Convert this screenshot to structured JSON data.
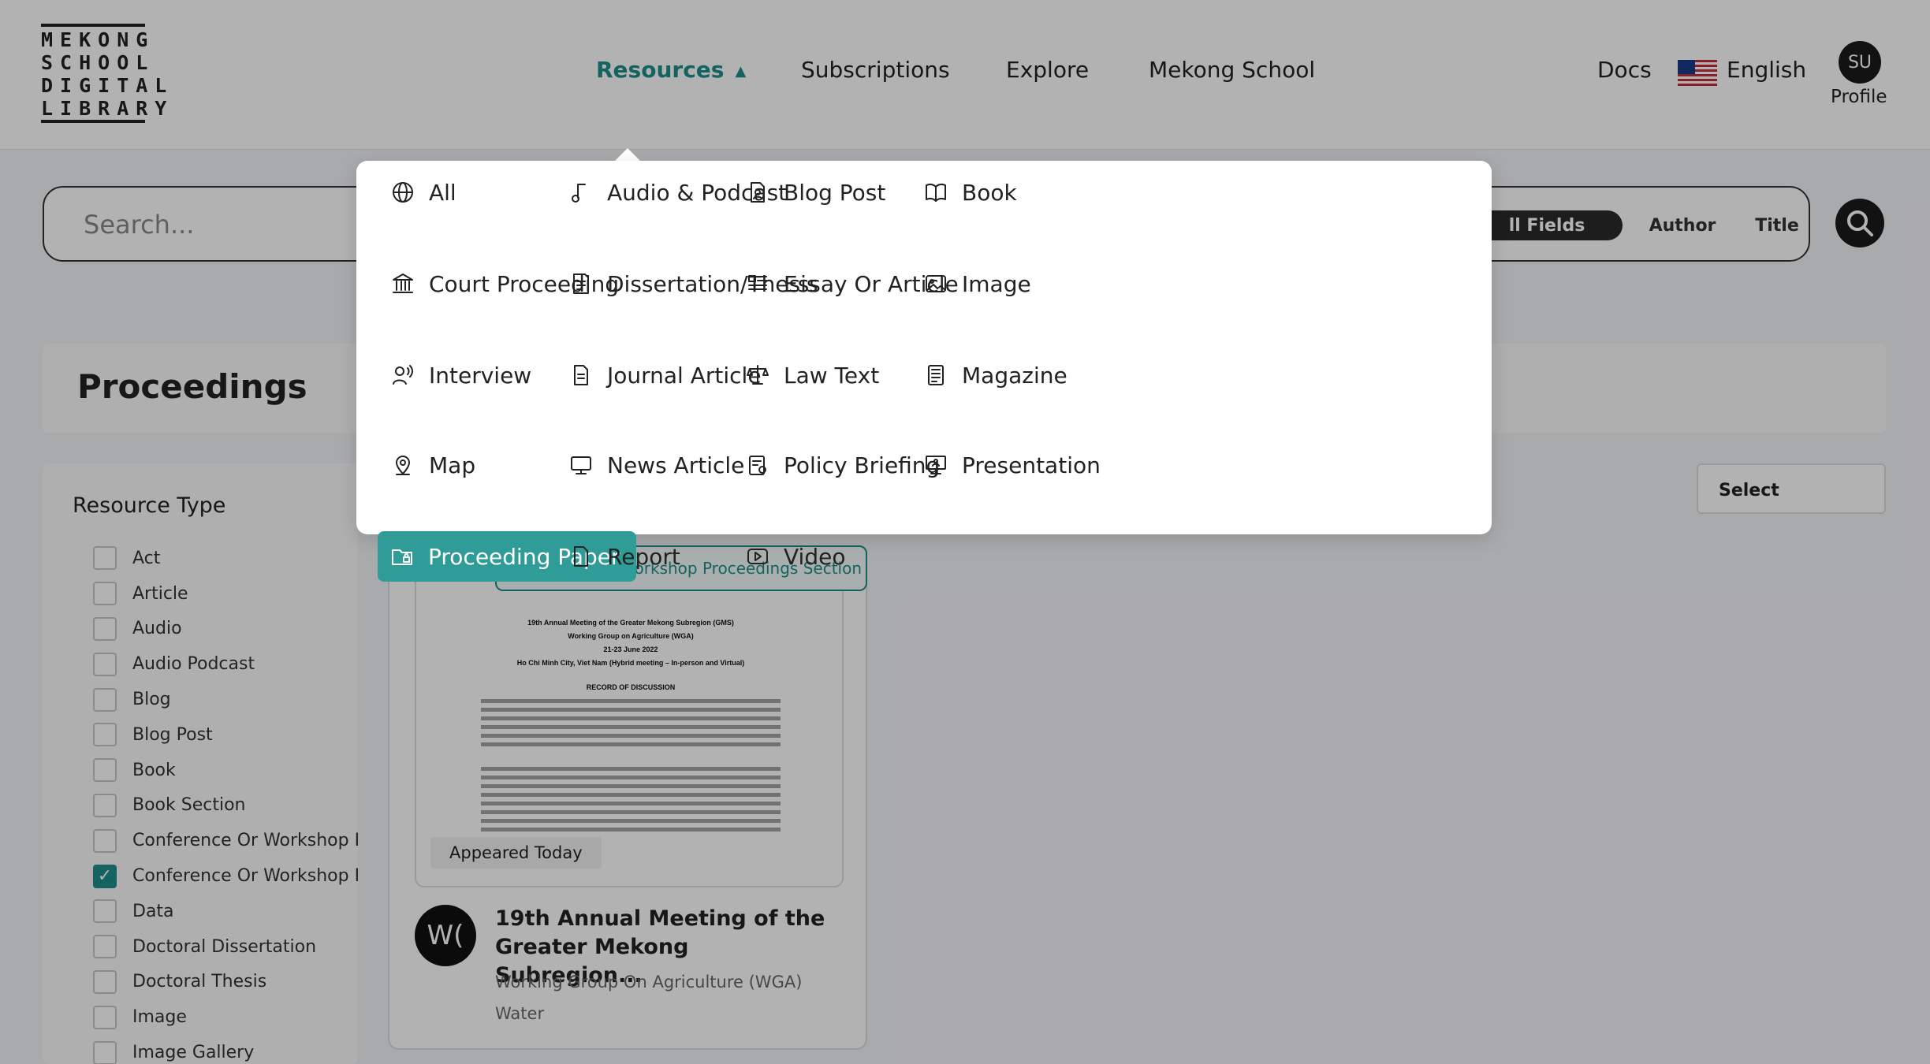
{
  "header": {
    "logo_lines": [
      "MEKONG",
      "SCHOOL",
      "DIGITAL",
      "LIBRARY"
    ],
    "nav": [
      {
        "label": "Resources",
        "active": true
      },
      {
        "label": "Subscriptions"
      },
      {
        "label": "Explore"
      },
      {
        "label": "Mekong School"
      }
    ],
    "docs_label": "Docs",
    "language": "English",
    "avatar_initials": "SU",
    "profile_label": "Profile"
  },
  "search": {
    "placeholder": "Search...",
    "scopes": [
      "All Fields",
      "Author",
      "Title"
    ],
    "active_scope_visible": "ll Fields"
  },
  "page": {
    "title": "Proceedings",
    "sort_select": "Select"
  },
  "sidebar": {
    "heading": "Resource Type",
    "filters": [
      {
        "label": "Act",
        "checked": false
      },
      {
        "label": "Article",
        "checked": false
      },
      {
        "label": "Audio",
        "checked": false
      },
      {
        "label": "Audio Podcast",
        "checked": false
      },
      {
        "label": "Blog",
        "checked": false
      },
      {
        "label": "Blog Post",
        "checked": false
      },
      {
        "label": "Book",
        "checked": false
      },
      {
        "label": "Book Section",
        "checked": false
      },
      {
        "label": "Conference Or Workshop Pr",
        "checked": false
      },
      {
        "label": "Conference Or Workshop Pr",
        "checked": true
      },
      {
        "label": "Data",
        "checked": false
      },
      {
        "label": "Doctoral Dissertation",
        "checked": false
      },
      {
        "label": "Doctoral Thesis",
        "checked": false
      },
      {
        "label": "Image",
        "checked": false
      },
      {
        "label": "Image Gallery",
        "checked": false
      }
    ]
  },
  "card": {
    "section_tag": "Conference Or Workshop Proceedings Section",
    "appeared": "Appeared Today",
    "author_initials": "W(",
    "title": "19th Annual Meeting of the Greater Mekong Subregion...",
    "author": "Working Group On Agriculture (WGA)",
    "topic": "Water",
    "doc_preview": {
      "heading_lines": [
        "19th Annual Meeting of the Greater Mekong Subregion (GMS)",
        "Working Group on Agriculture (WGA)",
        "21-23 June 2022",
        "Ho Chi Minh City, Viet Nam (Hybrid meeting – In-person and Virtual)"
      ],
      "section": "RECORD OF DISCUSSION"
    }
  },
  "dropdown": {
    "items": [
      {
        "label": "All",
        "icon": "globe-icon"
      },
      {
        "label": "Audio & Podcast",
        "icon": "music-note-icon"
      },
      {
        "label": "Blog Post",
        "icon": "document-person-icon"
      },
      {
        "label": "Book",
        "icon": "open-book-icon"
      },
      {
        "label": "Court Proceeding",
        "icon": "courthouse-icon"
      },
      {
        "label": "Dissertation/Thesis",
        "icon": "thesis-icon"
      },
      {
        "label": "Essay Or Article",
        "icon": "article-icon"
      },
      {
        "label": "Image",
        "icon": "image-icon"
      },
      {
        "label": "Interview",
        "icon": "interview-icon"
      },
      {
        "label": "Journal Article",
        "icon": "journal-icon"
      },
      {
        "label": "Law Text",
        "icon": "scales-icon"
      },
      {
        "label": "Magazine",
        "icon": "magazine-icon"
      },
      {
        "label": "Map",
        "icon": "map-pin-icon"
      },
      {
        "label": "News Article",
        "icon": "monitor-icon"
      },
      {
        "label": "Policy Briefing",
        "icon": "policy-icon"
      },
      {
        "label": "Presentation",
        "icon": "presentation-icon"
      },
      {
        "label": "Proceeding Paper",
        "icon": "folder-lock-icon",
        "active": true
      },
      {
        "label": "Report",
        "icon": "file-icon"
      },
      {
        "label": "Video",
        "icon": "video-icon"
      }
    ]
  },
  "colors": {
    "accent": "#1f8f8c",
    "active_bg": "#2f9c98"
  }
}
